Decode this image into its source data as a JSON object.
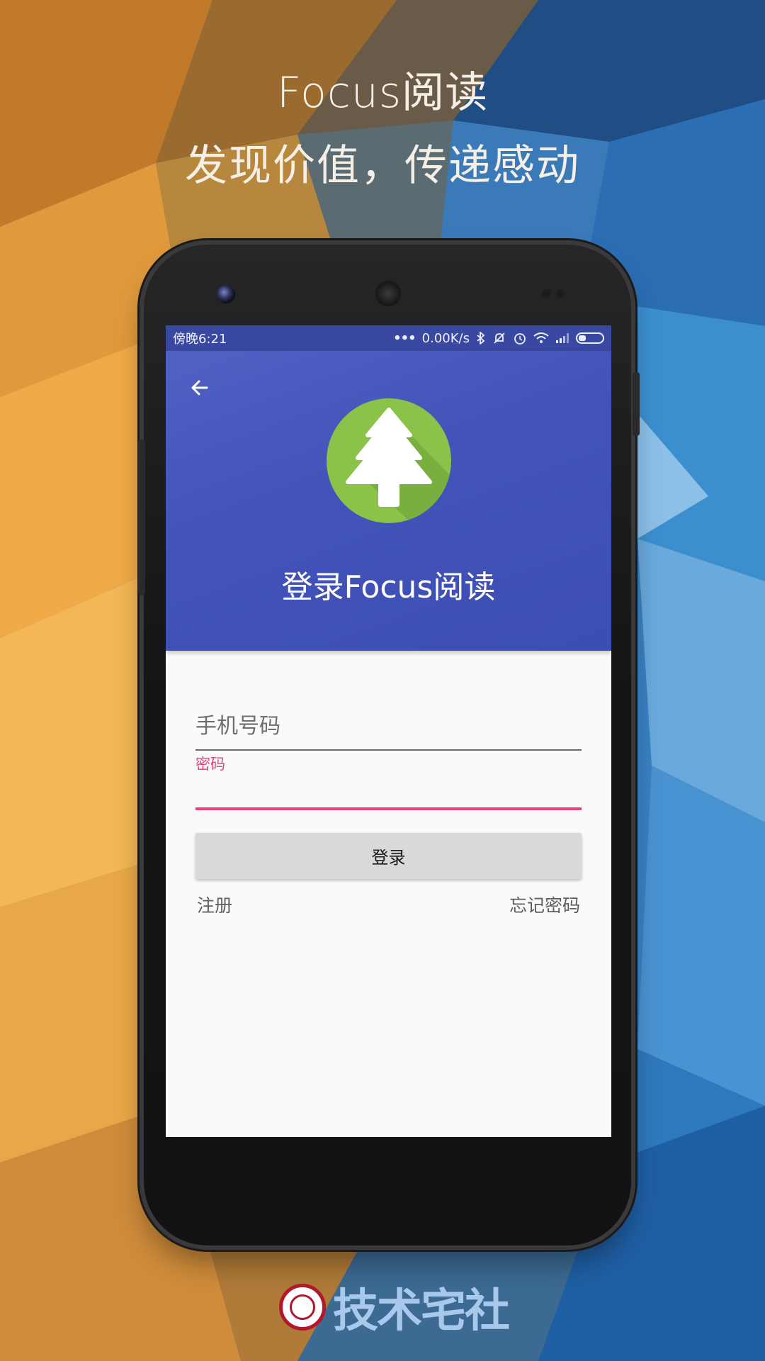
{
  "promo": {
    "line1": "Focus阅读",
    "line2": "发现价值，传递感动"
  },
  "status_bar": {
    "time": "傍晚6:21",
    "network_speed": "0.00K/s",
    "icons": [
      "more-dots-icon",
      "bluetooth-icon",
      "mute-icon",
      "alarm-icon",
      "wifi-icon",
      "signal-icon",
      "battery-icon"
    ]
  },
  "header": {
    "back_icon": "arrow-left-icon",
    "logo_icon": "pine-tree-icon",
    "title": "登录Focus阅读"
  },
  "form": {
    "phone_placeholder": "手机号码",
    "password_label": "密码",
    "password_value": "",
    "login_button": "登录",
    "register_link": "注册",
    "forgot_link": "忘记密码"
  },
  "footer": {
    "brand_text": "技术宅社"
  },
  "colors": {
    "primary": "#3f51b5",
    "status_bar": "#3948a0",
    "accent": "#e7437a",
    "logo_green": "#8bc34a"
  }
}
